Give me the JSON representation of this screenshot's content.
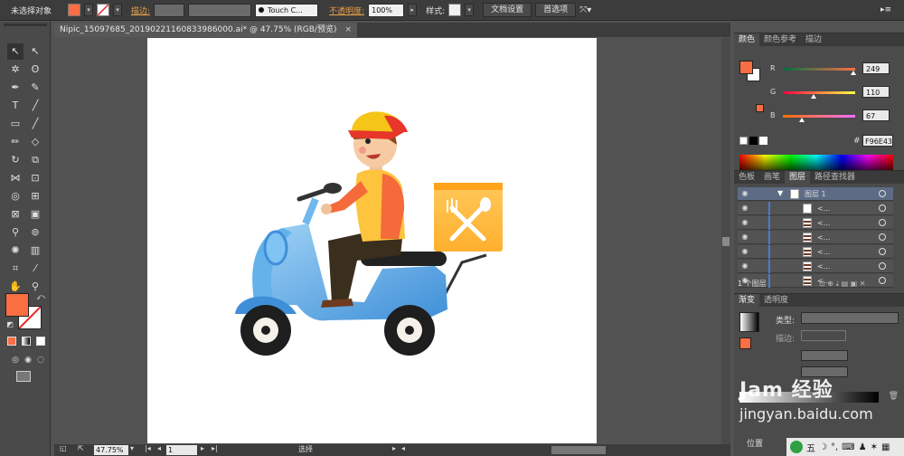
{
  "control_bar": {
    "selection_status": "未选择对象",
    "stroke_label": "描边:",
    "brush_name": "Touch C...",
    "opacity_label": "不透明度:",
    "opacity_value": "100%",
    "style_label": "样式:",
    "document_setup_button": "文档设置",
    "preferences_button": "首选项",
    "fill_color": "#f96e43"
  },
  "document": {
    "tab_title": "Nipic_15097685_20190221160833986000.ai* @ 47.75% (RGB/预览)",
    "close_glyph": "×"
  },
  "status_bar": {
    "zoom": "47.75%",
    "page": "1",
    "mode": "选择"
  },
  "color_panel": {
    "tabs": [
      "颜色",
      "颜色参考",
      "描边"
    ],
    "channels": [
      {
        "label": "R",
        "value": "249",
        "level": 0.976
      },
      {
        "label": "G",
        "value": "110",
        "level": 0.431
      },
      {
        "label": "B",
        "value": "67",
        "level": 0.263
      }
    ],
    "hex_symbol": "#",
    "hex_value": "F96E43"
  },
  "layers_panel": {
    "tabs": [
      "色板",
      "画笔",
      "图层",
      "路径查找器"
    ],
    "layer_name": "图层 1",
    "sublayer_label": "<...",
    "footer": "1 个图层"
  },
  "gradient_panel": {
    "tabs": [
      "渐变",
      "透明度"
    ],
    "type_label": "类型:",
    "stroke_label": "描边:",
    "position_label": "位置"
  },
  "watermark": {
    "line1": "Jam 经验",
    "line2": "jingyan.baidu.com"
  },
  "ime_bar": {
    "label": "五"
  },
  "colors": {
    "accent": "#f96e43",
    "canvas": "#ffffff",
    "workspace": "#535353"
  }
}
